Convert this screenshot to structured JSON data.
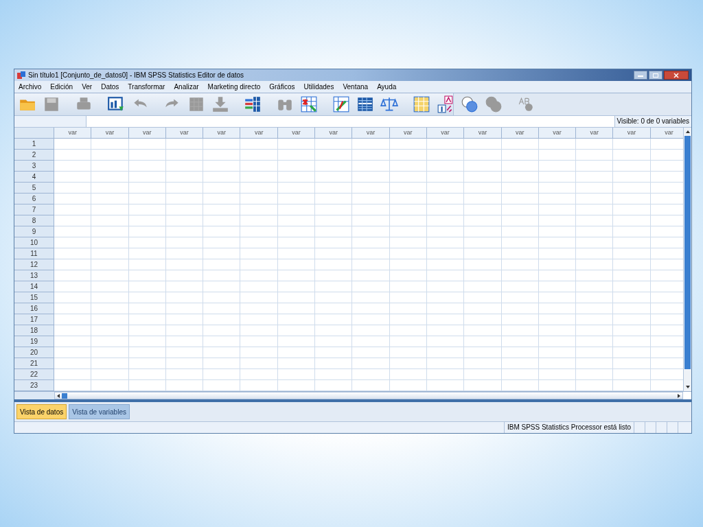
{
  "window": {
    "title": "Sin título1 [Conjunto_de_datos0] - IBM SPSS Statistics Editor de datos"
  },
  "menu": [
    "Archivo",
    "Edición",
    "Ver",
    "Datos",
    "Transformar",
    "Analizar",
    "Marketing directo",
    "Gráficos",
    "Utilidades",
    "Ventana",
    "Ayuda"
  ],
  "toolbar": [
    {
      "kind": "folder",
      "disabled": false
    },
    {
      "kind": "disk",
      "disabled": true
    },
    {
      "kind": "printer",
      "disabled": true
    },
    {
      "kind": "dialog",
      "disabled": false
    },
    {
      "kind": "undo",
      "disabled": true
    },
    {
      "kind": "redo",
      "disabled": true
    },
    {
      "kind": "grid",
      "disabled": true
    },
    {
      "kind": "download",
      "disabled": true
    },
    {
      "kind": "columns",
      "disabled": false
    },
    {
      "kind": "binoculars",
      "disabled": true
    },
    {
      "kind": "star",
      "disabled": false
    },
    {
      "kind": "chartgrid",
      "disabled": false
    },
    {
      "kind": "table",
      "disabled": false
    },
    {
      "kind": "scale",
      "disabled": false
    },
    {
      "kind": "yellowgrid",
      "disabled": false
    },
    {
      "kind": "labels",
      "disabled": false
    },
    {
      "kind": "circles",
      "disabled": false
    },
    {
      "kind": "circles",
      "disabled": true
    },
    {
      "kind": "spell",
      "disabled": true
    }
  ],
  "visible_label": "Visible: 0 de 0 variables",
  "columns": [
    "var",
    "var",
    "var",
    "var",
    "var",
    "var",
    "var",
    "var",
    "var",
    "var",
    "var",
    "var",
    "var",
    "var",
    "var",
    "var",
    "var"
  ],
  "rows": [
    "1",
    "2",
    "3",
    "4",
    "5",
    "6",
    "7",
    "8",
    "9",
    "10",
    "11",
    "12",
    "13",
    "14",
    "15",
    "16",
    "17",
    "18",
    "19",
    "20",
    "21",
    "22",
    "23"
  ],
  "tabs": [
    {
      "label": "Vista de datos",
      "selected": true
    },
    {
      "label": "Vista de variables",
      "selected": false
    }
  ],
  "status": "IBM SPSS Statistics Processor está listo"
}
